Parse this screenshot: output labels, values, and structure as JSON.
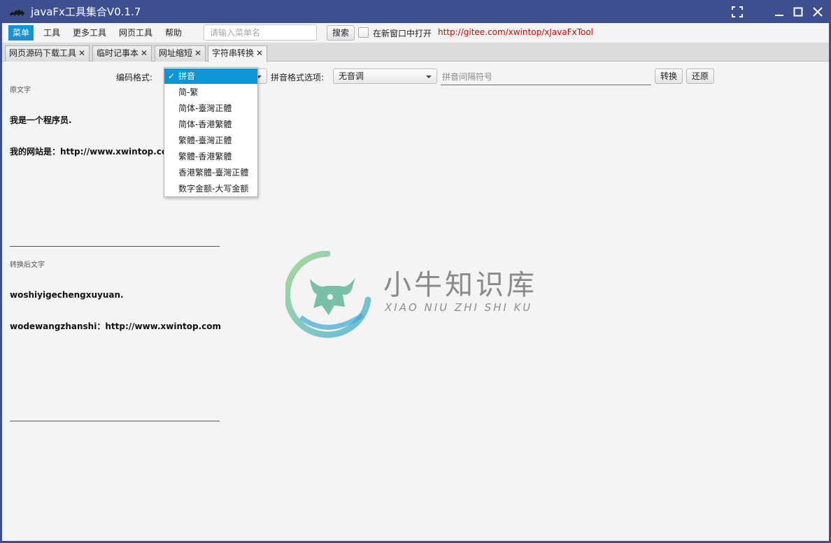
{
  "window": {
    "title": "javaFx工具集合V0.1.7"
  },
  "menubar": {
    "items": [
      "菜单",
      "工具",
      "更多工具",
      "网页工具",
      "帮助"
    ],
    "search_placeholder": "请输入菜单名",
    "search_button": "搜索",
    "new_window_label": "在新窗口中打开",
    "link_text": "http://gitee.com/xwintop/xJavaFxTool"
  },
  "tabs": [
    {
      "label": "网页源码下载工具"
    },
    {
      "label": "临时记事本"
    },
    {
      "label": "网址缩短"
    },
    {
      "label": "字符串转换"
    }
  ],
  "form": {
    "encoding_label": "编码格式:",
    "encoding_value": "拼音",
    "pinyin_option_label": "拼音格式选项:",
    "pinyin_option_value": "无音调",
    "separator_placeholder": "拼音间隔符号",
    "convert_button": "转换",
    "restore_button": "还原"
  },
  "dropdown": {
    "options": [
      "拼音",
      "简-繁",
      "简体-臺灣正體",
      "简体-香港繁體",
      "繁體-臺灣正體",
      "繁體-香港繁體",
      "香港繁體-臺灣正體",
      "数字金额-大写金额"
    ],
    "selected_index": 0
  },
  "source": {
    "label": "原文字",
    "lines": [
      "我是一个程序员.",
      "我的网站是：http://www.xwintop.com"
    ]
  },
  "result": {
    "label": "转换后文字",
    "lines": [
      "woshiyigechengxuyuan.",
      "wodewangzhanshi：http://www.xwintop.com"
    ]
  },
  "watermark": {
    "title": "小牛知识库",
    "subtitle": "XIAO NIU ZHI SHI KU"
  },
  "colors": {
    "titlebar": "#3e4f8f",
    "accent": "#0c96d6",
    "link": "#e00000"
  }
}
